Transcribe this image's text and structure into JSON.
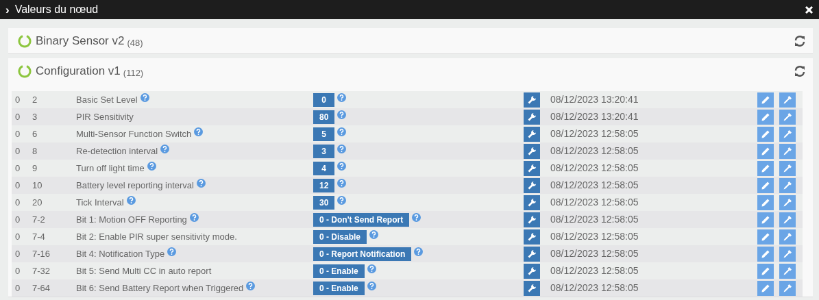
{
  "window": {
    "title": "Valeurs du nœud",
    "collapse_icon": "›"
  },
  "panels": [
    {
      "title": "Binary Sensor v2",
      "count": "(48)",
      "expanded": false
    },
    {
      "title": "Configuration v1",
      "count": "(112)",
      "expanded": true,
      "rows": [
        {
          "instance": "0",
          "index": "2",
          "label": "Basic Set Level",
          "label_help": true,
          "value": "0",
          "date": "08/12/2023 13:20:41"
        },
        {
          "instance": "0",
          "index": "3",
          "label": "PIR Sensitivity",
          "label_help": false,
          "value": "80",
          "date": "08/12/2023 13:20:41"
        },
        {
          "instance": "0",
          "index": "6",
          "label": "Multi-Sensor Function Switch",
          "label_help": true,
          "value": "5",
          "date": "08/12/2023 12:58:05"
        },
        {
          "instance": "0",
          "index": "8",
          "label": "Re-detection interval",
          "label_help": true,
          "value": "3",
          "date": "08/12/2023 12:58:05"
        },
        {
          "instance": "0",
          "index": "9",
          "label": "Turn off light time",
          "label_help": true,
          "value": "4",
          "date": "08/12/2023 12:58:05"
        },
        {
          "instance": "0",
          "index": "10",
          "label": "Battery level reporting interval",
          "label_help": true,
          "value": "12",
          "date": "08/12/2023 12:58:05"
        },
        {
          "instance": "0",
          "index": "20",
          "label": "Tick Interval",
          "label_help": true,
          "value": "30",
          "date": "08/12/2023 12:58:05"
        },
        {
          "instance": "0",
          "index": "7-2",
          "label": "Bit 1: Motion OFF Reporting",
          "label_help": true,
          "value": "0 - Don't Send Report",
          "date": "08/12/2023 12:58:05"
        },
        {
          "instance": "0",
          "index": "7-4",
          "label": "Bit 2: Enable PIR super sensitivity mode.",
          "label_help": false,
          "value": "0 - Disable",
          "date": "08/12/2023 12:58:05"
        },
        {
          "instance": "0",
          "index": "7-16",
          "label": "Bit 4: Notification Type",
          "label_help": true,
          "value": "0 - Report Notification",
          "date": "08/12/2023 12:58:05"
        },
        {
          "instance": "0",
          "index": "7-32",
          "label": "Bit 5: Send Multi CC in auto report",
          "label_help": false,
          "value": "0 - Enable",
          "date": "08/12/2023 12:58:05"
        },
        {
          "instance": "0",
          "index": "7-64",
          "label": "Bit 6: Send Battery Report when Triggered",
          "label_help": true,
          "value": "0 - Enable",
          "date": "08/12/2023 12:58:05"
        }
      ]
    }
  ]
}
